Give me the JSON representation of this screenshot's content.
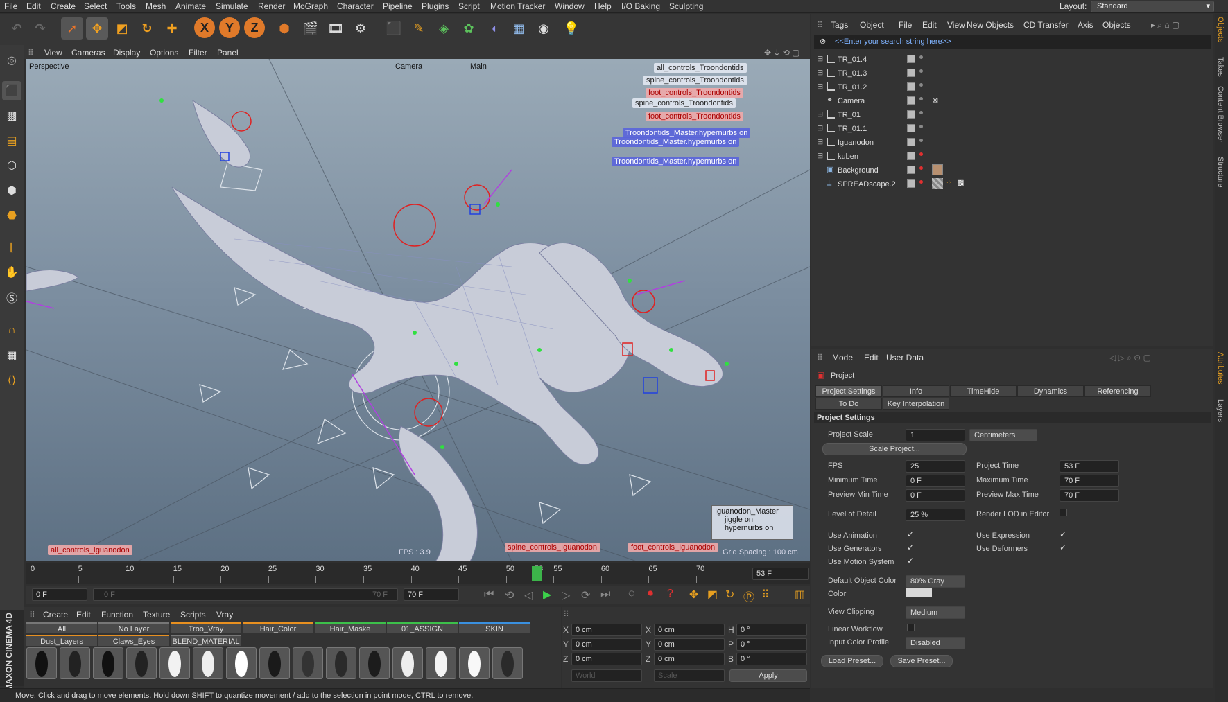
{
  "menubar": {
    "items": [
      "File",
      "Edit",
      "Create",
      "Select",
      "Tools",
      "Mesh",
      "Animate",
      "Simulate",
      "Render",
      "MoGraph",
      "Character",
      "Pipeline",
      "Plugins",
      "Script",
      "Motion Tracker",
      "Window",
      "Help",
      "I/O Baking",
      "Sculpting"
    ],
    "layout_label": "Layout:",
    "layout_value": "Standard"
  },
  "toolbar": {
    "axis": [
      "X",
      "Y",
      "Z"
    ]
  },
  "viewport": {
    "menu": [
      "View",
      "Cameras",
      "Display",
      "Options",
      "Filter",
      "Panel"
    ],
    "label": "Perspective",
    "camera": "Camera",
    "main": "Main",
    "fps": "FPS : 3.9",
    "grid": "Grid Spacing : 100 cm",
    "tags": [
      {
        "text": "all_controls_Troondontids",
        "style": "w"
      },
      {
        "text": "spine_controls_Troondontids",
        "style": "w"
      },
      {
        "text": "foot_controls_Troondontids",
        "style": "r"
      },
      {
        "text": "spine_controls_Troondontids",
        "style": "w"
      },
      {
        "text": "foot_controls_Troondontids",
        "style": "r"
      },
      {
        "text": "Troondontids_Master.hypernurbs on",
        "style": "b"
      },
      {
        "text": "Troondontids_Master.hypernurbs on",
        "style": "b"
      },
      {
        "text": "Troondontids_Master.hypernurbs on",
        "style": "b"
      }
    ],
    "bottom_tags": [
      "all_controls_Iguanodon",
      "spine_controls_Iguanodon",
      "foot_controls_Iguanodon"
    ],
    "iguanodon_box": {
      "title": "Iguanodon_Master",
      "items": [
        "jiggle on",
        "hypernurbs on"
      ]
    }
  },
  "timeline": {
    "ticks": [
      "0",
      "5",
      "10",
      "15",
      "20",
      "25",
      "30",
      "35",
      "40",
      "45",
      "50",
      "53",
      "55",
      "60",
      "65",
      "70"
    ],
    "current": "53 F",
    "current_frame": 53,
    "max_frame": 70
  },
  "transport": {
    "start": "0 F",
    "min": "0 F",
    "end": "70 F",
    "max": "70 F"
  },
  "materials": {
    "menu": [
      "Create",
      "Edit",
      "Function",
      "Texture",
      "Scripts",
      "Vray"
    ],
    "layers_row1": [
      "All",
      "No Layer",
      "Troo_Vray",
      "Hair_Color",
      "Hair_Maske",
      "01_ASSIGN",
      "SKIN"
    ],
    "layers_row2": [
      "Dust_Layers",
      "Claws_Eyes",
      "BLEND_MATERIAL"
    ],
    "brand": "MAXON CINEMA 4D"
  },
  "coords": {
    "rows": [
      {
        "a": "X",
        "av": "0 cm",
        "b": "X",
        "bv": "0 cm",
        "c": "H",
        "cv": "0 °"
      },
      {
        "a": "Y",
        "av": "0 cm",
        "b": "Y",
        "bv": "0 cm",
        "c": "P",
        "cv": "0 °"
      },
      {
        "a": "Z",
        "av": "0 cm",
        "b": "Z",
        "bv": "0 cm",
        "c": "B",
        "cv": "0 °"
      }
    ],
    "world": "World",
    "scale": "Scale",
    "apply": "Apply"
  },
  "status": "Move: Click and drag to move elements. Hold down SHIFT to quantize movement / add to the selection in point mode, CTRL to remove.",
  "objects": {
    "menu": [
      "Tags",
      "Object",
      "File",
      "Edit",
      "View",
      "New Objects",
      "CD Transfer",
      "Axis",
      "Objects"
    ],
    "search": "<<Enter your search string here>>",
    "items": [
      "TR_01.4",
      "TR_01.3",
      "TR_01.2",
      "Camera",
      "TR_01",
      "TR_01.1",
      "Iguanodon",
      "kuben",
      "Background",
      "SPREADscape.2"
    ]
  },
  "attributes": {
    "menu": [
      "Mode",
      "Edit",
      "User Data"
    ],
    "title": "Project",
    "tabs": [
      "Project Settings",
      "Info",
      "TimeHide",
      "Dynamics",
      "Referencing",
      "To Do",
      "Key Interpolation"
    ],
    "section": "Project Settings",
    "project_scale_label": "Project Scale",
    "project_scale": "1",
    "units": "Centimeters",
    "scale_btn": "Scale Project...",
    "fps_label": "FPS",
    "fps": "25",
    "ptime_label": "Project Time",
    "ptime": "53 F",
    "min_label": "Minimum Time",
    "min": "0 F",
    "max_label": "Maximum Time",
    "max": "70 F",
    "pmin_label": "Preview Min Time",
    "pmin": "0 F",
    "pmax_label": "Preview Max Time",
    "pmax": "70 F",
    "lod_label": "Level of Detail",
    "lod": "25 %",
    "rlod_label": "Render LOD in Editor",
    "anim_label": "Use Animation",
    "expr_label": "Use Expression",
    "gen_label": "Use Generators",
    "def_label": "Use Deformers",
    "motion_label": "Use Motion System",
    "doc_label": "Default Object Color",
    "doc": "80% Gray",
    "color_label": "Color",
    "clip_label": "View Clipping",
    "clip": "Medium",
    "lw_label": "Linear Workflow",
    "icp_label": "Input Color Profile",
    "icp": "Disabled",
    "load": "Load Preset...",
    "save": "Save Preset..."
  },
  "rightstrip": [
    "Objects",
    "Takes",
    "Content Browser",
    "Structure",
    "Attributes",
    "Layers"
  ]
}
